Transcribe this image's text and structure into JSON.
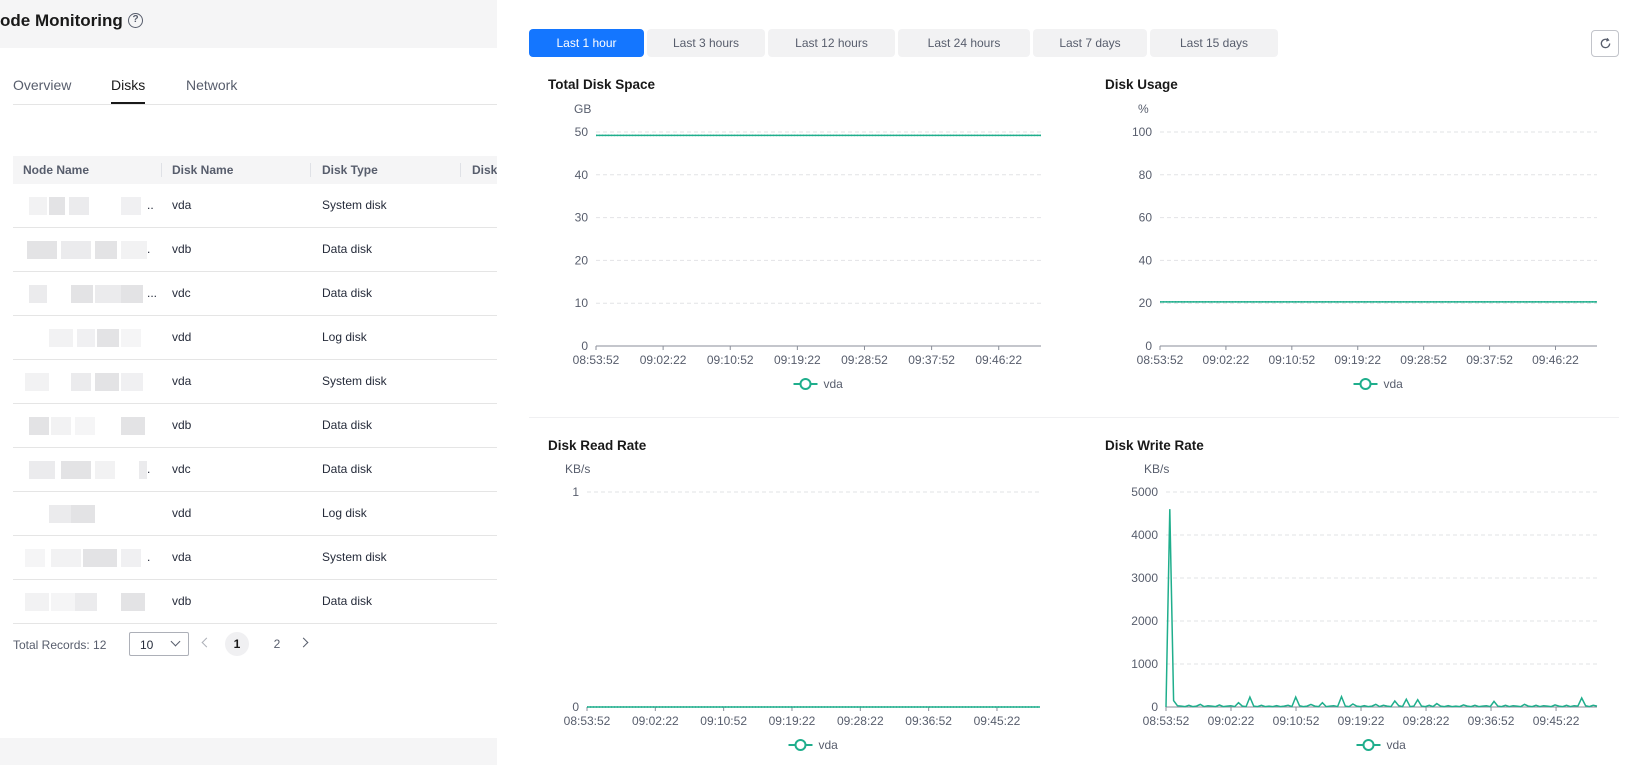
{
  "app": {
    "title": "ode Monitoring"
  },
  "tabs": [
    {
      "label": "Overview",
      "active": false
    },
    {
      "label": "Disks",
      "active": true
    },
    {
      "label": "Network",
      "active": false
    }
  ],
  "table": {
    "columns": [
      "Node Name",
      "Disk Name",
      "Disk Type",
      "Disk"
    ],
    "rows": [
      {
        "node": "..",
        "disk": "vda",
        "type": "System disk"
      },
      {
        "node": ".",
        "disk": "vdb",
        "type": "Data disk"
      },
      {
        "node": "...",
        "disk": "vdc",
        "type": "Data disk"
      },
      {
        "node": "",
        "disk": "vdd",
        "type": "Log disk"
      },
      {
        "node": "",
        "disk": "vda",
        "type": "System disk"
      },
      {
        "node": "",
        "disk": "vdb",
        "type": "Data disk"
      },
      {
        "node": ".",
        "disk": "vdc",
        "type": "Data disk"
      },
      {
        "node": "",
        "disk": "vdd",
        "type": "Log disk"
      },
      {
        "node": ".",
        "disk": "vda",
        "type": "System disk"
      },
      {
        "node": "",
        "disk": "vdb",
        "type": "Data disk"
      }
    ]
  },
  "pagination": {
    "total_label": "Total Records: 12",
    "page_size": "10",
    "pages": [
      "1",
      "2"
    ],
    "current_page": "1"
  },
  "time_ranges": [
    {
      "label": "Last 1 hour",
      "active": true
    },
    {
      "label": "Last 3 hours",
      "active": false
    },
    {
      "label": "Last 12 hours",
      "active": false
    },
    {
      "label": "Last 24 hours",
      "active": false
    },
    {
      "label": "Last 7 days",
      "active": false
    },
    {
      "label": "Last 15 days",
      "active": false
    }
  ],
  "icons": {
    "help": "help-circle-icon",
    "refresh": "refresh-icon",
    "page_size": "chevron-down-icon",
    "prev": "chevron-left-icon",
    "next": "chevron-right-icon"
  },
  "colors": {
    "accent": "#1476ff",
    "series": "#1fae8c"
  },
  "chart_data": [
    {
      "type": "line",
      "title": "Total Disk Space",
      "ylabel": "GB",
      "ylim": [
        0,
        50
      ],
      "yticks": [
        "0",
        "10",
        "20",
        "30",
        "40",
        "50"
      ],
      "xticks": [
        "08:53:52",
        "09:02:22",
        "09:10:52",
        "09:19:22",
        "09:28:52",
        "09:37:52",
        "09:46:22"
      ],
      "legend": "bottom-center",
      "grid": true,
      "series": [
        {
          "name": "vda",
          "values": [
            49.2,
            49.2
          ]
        }
      ]
    },
    {
      "type": "line",
      "title": "Disk Usage",
      "ylabel": "%",
      "ylim": [
        0,
        100
      ],
      "yticks": [
        "0",
        "20",
        "40",
        "60",
        "80",
        "100"
      ],
      "xticks": [
        "08:53:52",
        "09:02:22",
        "09:10:52",
        "09:19:22",
        "09:28:52",
        "09:37:52",
        "09:46:22"
      ],
      "legend": "bottom-center",
      "grid": true,
      "series": [
        {
          "name": "vda",
          "values": [
            20.6,
            20.6
          ]
        }
      ]
    },
    {
      "type": "line",
      "title": "Disk Read Rate",
      "ylabel": "KB/s",
      "ylim": [
        0,
        1
      ],
      "yticks": [
        "0",
        "1"
      ],
      "xticks": [
        "08:53:52",
        "09:02:22",
        "09:10:52",
        "09:19:22",
        "09:28:22",
        "09:36:52",
        "09:45:22"
      ],
      "legend": "bottom-center",
      "grid": true,
      "series": [
        {
          "name": "vda",
          "values": [
            0,
            0
          ]
        }
      ]
    },
    {
      "type": "line",
      "title": "Disk Write Rate",
      "ylabel": "KB/s",
      "ylim": [
        0,
        5000
      ],
      "yticks": [
        "0",
        "1000",
        "2000",
        "3000",
        "4000",
        "5000"
      ],
      "xticks": [
        "08:53:52",
        "09:02:22",
        "09:10:52",
        "09:19:22",
        "09:28:22",
        "09:36:52",
        "09:45:22"
      ],
      "legend": "bottom-center",
      "grid": true,
      "series": [
        {
          "name": "vda",
          "values": [
            0,
            4600,
            150,
            30,
            20,
            10,
            40,
            10,
            20,
            60,
            10,
            30,
            20,
            10,
            50,
            10,
            20,
            30,
            10,
            100,
            20,
            10,
            230,
            20,
            10,
            40,
            10,
            20,
            10,
            30,
            10,
            20,
            40,
            10,
            230,
            30,
            10,
            20,
            60,
            20,
            10,
            100,
            10,
            20,
            30,
            10,
            240,
            20,
            10,
            70,
            20,
            10,
            30,
            10,
            20,
            60,
            10,
            40,
            20,
            10,
            140,
            30,
            10,
            180,
            10,
            20,
            170,
            20,
            10,
            40,
            10,
            80,
            20,
            10,
            30,
            10,
            20,
            10,
            50,
            20,
            10,
            40,
            10,
            20,
            30,
            10,
            130,
            20,
            10,
            40,
            10,
            30,
            20,
            10,
            60,
            20,
            10,
            40,
            10,
            30,
            20,
            10,
            50,
            20,
            10,
            40,
            10,
            30,
            20,
            210,
            30,
            10,
            40,
            20
          ]
        }
      ]
    }
  ]
}
